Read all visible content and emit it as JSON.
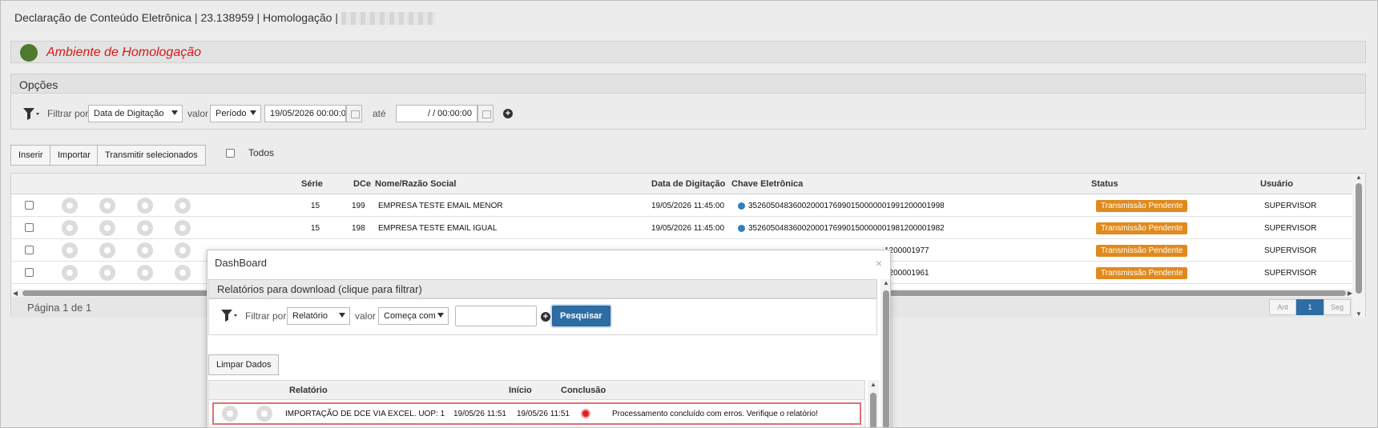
{
  "header": {
    "title": "Declaração de Conteúdo Eletrônica | 23.138959 | Homologação |"
  },
  "environment": {
    "label": "Ambiente de Homologação",
    "indicator_color": "#4e7a2e"
  },
  "options": {
    "title": "Opções",
    "filter_by_label": "Filtrar por",
    "filter_field": "Data de Digitação",
    "value_label": "valor",
    "value_operator": "Período",
    "date_from": "19/05/2026 00:00:0",
    "until_label": "até",
    "date_to": "/ /      00:00:00"
  },
  "toolbar": {
    "insert": "Inserir",
    "import": "Importar",
    "transmit_selected": "Transmitir selecionados",
    "all_label": "Todos"
  },
  "grid": {
    "columns": [
      "Série",
      "DCe",
      "Nome/Razão Social",
      "Data de Digitação",
      "Chave Eletrônica",
      "Status",
      "Usuário"
    ],
    "rows": [
      {
        "serie": "15",
        "dce": "199",
        "name": "EMPRESA TESTE EMAIL MENOR",
        "date": "19/05/2026 11:45:00",
        "key": "35260504836002000176990150000001991200001998",
        "status": "Transmissão Pendente",
        "user": "SUPERVISOR"
      },
      {
        "serie": "15",
        "dce": "198",
        "name": "EMPRESA TESTE EMAIL IGUAL",
        "date": "19/05/2026 11:45:00",
        "key": "35260504836002000176990150000001981200001982",
        "status": "Transmissão Pendente",
        "user": "SUPERVISOR"
      },
      {
        "serie": "",
        "dce": "",
        "name": "",
        "date": "",
        "key": "1200001977",
        "status": "Transmissão Pendente",
        "user": "SUPERVISOR"
      },
      {
        "serie": "",
        "dce": "",
        "name": "",
        "date": "",
        "key": "1200001961",
        "status": "Transmissão Pendente",
        "user": "SUPERVISOR"
      }
    ],
    "status_color": "#e08a1e",
    "page_info": "Página 1 de 1",
    "pager": {
      "prev": "Ant",
      "current": "1",
      "next": "Seg"
    }
  },
  "dashboard": {
    "title": "DashBoard",
    "close_icon": "×",
    "section_title": "Relatórios para download (clique para filtrar)",
    "filter_by_label": "Filtrar por",
    "filter_field": "Relatório",
    "value_label": "valor",
    "value_operator": "Começa com",
    "search_button": "Pesquisar",
    "clear_button": "Limpar Dados",
    "columns": {
      "report": "Relatório",
      "start": "Início",
      "end": "Conclusão"
    },
    "rows": [
      {
        "report": "IMPORTAÇÃO DE DCE VIA EXCEL. UOP: 1",
        "start": "19/05/26 11:51",
        "end": "19/05/26 11:51",
        "message": "Processamento concluído com erros. Verifique o relatório!"
      }
    ]
  }
}
